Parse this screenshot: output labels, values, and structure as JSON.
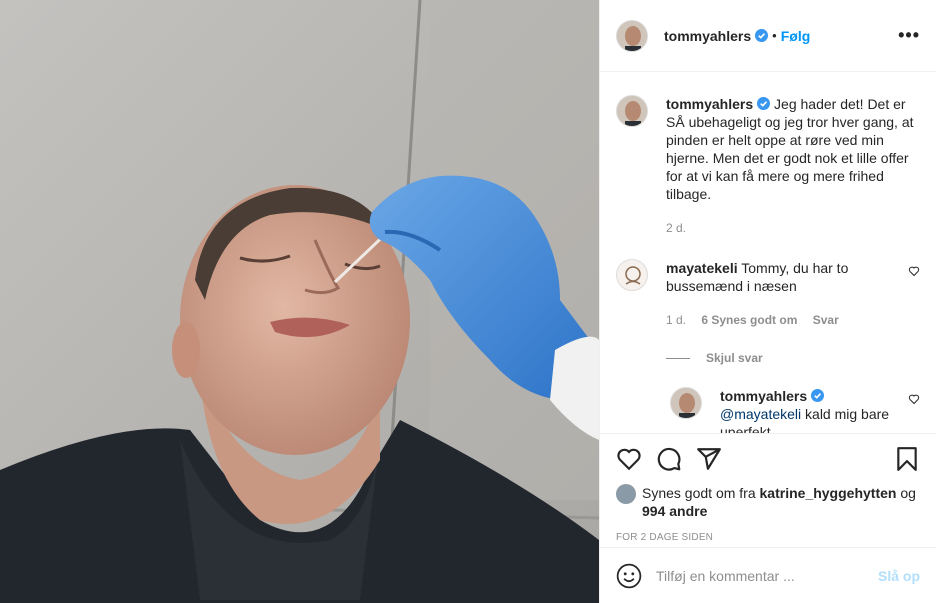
{
  "photo": {
    "description_icon": "photo-icon"
  },
  "header": {
    "username": "tommyahlers",
    "separator": "•",
    "follow_label": "Følg",
    "more_label": "•••"
  },
  "caption": {
    "username": "tommyahlers",
    "text": "Jeg hader det! Det er SÅ ubehageligt og jeg tror hver gang, at pinden er helt oppe at røre ved min hjerne. Men det er godt nok et lille offer for at vi kan få mere og mere frihed tilbage.",
    "time": "2 d."
  },
  "comments": [
    {
      "username": "mayatekeli",
      "text": "Tommy, du har to bussemænd i næsen",
      "time": "1 d.",
      "likes": "6 Synes godt om",
      "reply_label": "Svar"
    }
  ],
  "hide_replies_label": "Skjul svar",
  "reply": {
    "username": "tommyahlers",
    "mention": "@mayatekeli",
    "text": " kald mig bare uperfekt"
  },
  "likes": {
    "prefix": "Synes godt om fra ",
    "user": "katrine_hyggehytten",
    "middle": " og ",
    "count": "994 andre"
  },
  "timestamp": "FOR 2 DAGE SIDEN",
  "add_comment": {
    "placeholder": "Tilføj en kommentar ...",
    "post_label": "Slå op"
  },
  "colors": {
    "accent": "#0095f6",
    "verified": "#3897f0",
    "post_disabled": "#b2dffc"
  }
}
